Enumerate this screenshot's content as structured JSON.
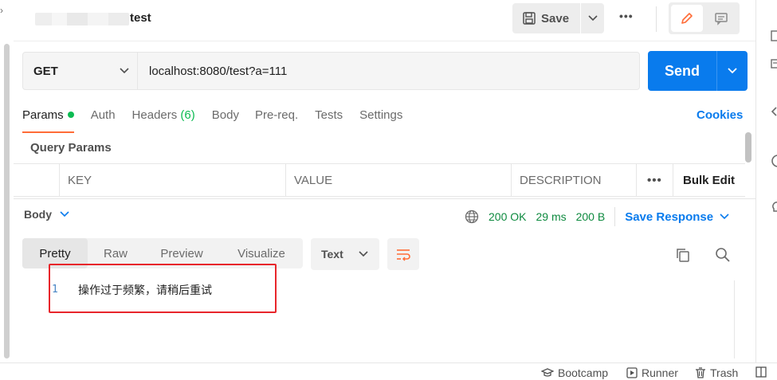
{
  "header": {
    "title": "test",
    "save_label": "Save"
  },
  "request": {
    "method": "GET",
    "url": "localhost:8080/test?a=111",
    "send_label": "Send"
  },
  "tabs": [
    {
      "label": "Params"
    },
    {
      "label": "Auth"
    },
    {
      "label": "Headers",
      "count": "(6)"
    },
    {
      "label": "Body"
    },
    {
      "label": "Pre-req."
    },
    {
      "label": "Tests"
    },
    {
      "label": "Settings"
    }
  ],
  "cookies_label": "Cookies",
  "query_params": {
    "label": "Query Params",
    "columns": [
      "KEY",
      "VALUE",
      "DESCRIPTION"
    ],
    "bulk_edit_label": "Bulk Edit"
  },
  "response": {
    "body_label": "Body",
    "status": "200 OK",
    "time": "29 ms",
    "size": "200 B",
    "save_response_label": "Save Response",
    "format_tabs": [
      "Pretty",
      "Raw",
      "Preview",
      "Visualize"
    ],
    "format_select": "Text",
    "lines": [
      {
        "number": "1",
        "text": "操作过于频繁，请稍后重试"
      }
    ]
  },
  "statusbar": {
    "bootcamp": "Bootcamp",
    "runner": "Runner",
    "trash": "Trash"
  },
  "colors": {
    "accent": "#097bed",
    "active_tab": "#ff6c37",
    "success": "#0cbb52",
    "highlight_box": "#e8262b"
  }
}
